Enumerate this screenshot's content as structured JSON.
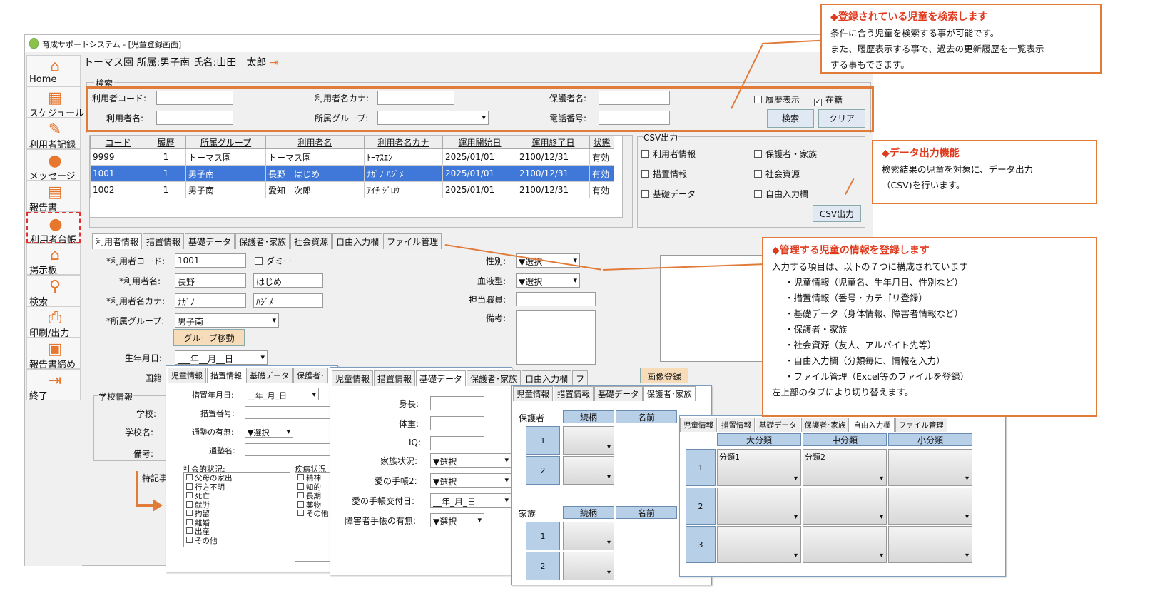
{
  "window": {
    "title": "育成サポートシステム - [児童登録画面]",
    "header": "トーマス園 所属:男子南 氏名:山田　太郎"
  },
  "sidebar": [
    "Home",
    "スケジュール",
    "利用者記録",
    "メッセージ",
    "報告書",
    "利用者台帳",
    "掲示板",
    "検索",
    "印刷/出力",
    "報告書締め",
    "終了"
  ],
  "search": {
    "legend": "検索",
    "code_label": "利用者コード:",
    "kana_label": "利用者名カナ:",
    "guardian_label": "保護者名:",
    "name_label": "利用者名:",
    "group_label": "所属グループ:",
    "phone_label": "電話番号:",
    "history": "履歴表示",
    "enrolled": "在籍",
    "search_btn": "検索",
    "clear_btn": "クリア"
  },
  "grid": {
    "headers": [
      "コード",
      "履歴",
      "所属グループ",
      "利用者名",
      "利用者名カナ",
      "運用開始日",
      "運用終了日",
      "状態"
    ],
    "rows": [
      [
        "9999",
        "1",
        "トーマス園",
        "トーマス園",
        "ﾄｰﾏｽｴﾝ",
        "2025/01/01",
        "2100/12/31",
        "有効"
      ],
      [
        "1001",
        "1",
        "男子南",
        "長野　はじめ",
        "ﾅｶﾞﾉ ﾊｼﾞﾒ",
        "2025/01/01",
        "2100/12/31",
        "有効"
      ],
      [
        "1002",
        "1",
        "男子南",
        "愛知　次郎",
        "ｱｲﾁ ｼﾞﾛｳ",
        "2025/01/01",
        "2100/12/31",
        "有効"
      ]
    ]
  },
  "csv": {
    "legend": "CSV出力",
    "opts": [
      "利用者情報",
      "保護者・家族",
      "措置情報",
      "社会資源",
      "基礎データ",
      "自由入力欄"
    ],
    "btn": "CSV出力"
  },
  "tabs": [
    "利用者情報",
    "措置情報",
    "基礎データ",
    "保護者･家族",
    "社会資源",
    "自由入力欄",
    "ファイル管理"
  ],
  "form": {
    "code_label": "*利用者コード:",
    "code": "1001",
    "dummy": "ダミー",
    "name_label": "*利用者名:",
    "last": "長野",
    "first": "はじめ",
    "kana_label": "*利用者名カナ:",
    "last_kana": "ﾅｶﾞﾉ",
    "first_kana": "ﾊｼﾞﾒ",
    "group_label": "*所属グループ:",
    "group": "男子南",
    "group_move": "グループ移動",
    "birth_label": "生年月日:",
    "birth": "___年__月__日",
    "nation": "国籍",
    "school": "学校情報",
    "school1": "学校:",
    "school2": "学校名:",
    "remark_s": "備考:",
    "special": "特記事",
    "sex_label": "性別:",
    "sex": "▼選択",
    "blood_label": "血液型:",
    "blood": "▼選択",
    "staff_label": "担当職員:",
    "note_label": "備考:",
    "image_btn": "画像登録"
  },
  "p1": {
    "tabs": [
      "児童情報",
      "措置情報",
      "基礎データ",
      "保護者･"
    ],
    "date_label": "措置年月日:",
    "date": "__年_月_日",
    "num_label": "措置番号:",
    "juku_label": "通塾の有無:",
    "juku": "▼選択",
    "jukuname_label": "通塾名:",
    "social": "社会的状況:",
    "social_items": [
      "父母の家出",
      "行方不明",
      "死亡",
      "就労",
      "拘留",
      "離婚",
      "出産",
      "その他"
    ],
    "disease": "疾病状況",
    "disease_items": [
      "精神",
      "知的",
      "長期",
      "薬物",
      "その他"
    ]
  },
  "p2": {
    "tabs": [
      "児童情報",
      "措置情報",
      "基礎データ",
      "保護者･家族",
      "自由入力欄",
      "フ"
    ],
    "height": "身長:",
    "weight": "体重:",
    "iq": "IQ:",
    "family": "家族状況:",
    "family_v": "▼選択",
    "techo": "愛の手帳2:",
    "techo_v": "▼選択",
    "techo_date": "愛の手帳交付日:",
    "techo_date_v": "__年_月_日",
    "shogai": "障害者手帳の有無:",
    "shogai_v": "▼選択"
  },
  "p3": {
    "tabs": [
      "児童情報",
      "措置情報",
      "基礎データ",
      "保護者･家族"
    ],
    "guardian": "保護者",
    "family": "家族",
    "rel": "続柄",
    "name": "名前",
    "n1": "1",
    "n2": "2"
  },
  "p4": {
    "tabs": [
      "児童情報",
      "措置情報",
      "基礎データ",
      "保護者･家族",
      "自由入力欄",
      "ファイル管理"
    ],
    "big": "大分類",
    "mid": "中分類",
    "small": "小分類",
    "r1": "1",
    "r2": "2",
    "r3": "3",
    "v1": "分類1",
    "v2": "分類2"
  },
  "callouts": {
    "search_title": "◆登録されている児童を検索します",
    "search_body": [
      "条件に合う児童を検索する事が可能です。",
      "また、履歴表示する事で、過去の更新履歴を一覧表示",
      "する事もできます。"
    ],
    "csv_title": "◆データ出力機能",
    "csv_body": [
      "検索結果の児童を対象に、データ出力",
      "（CSV)を行います。"
    ],
    "manage_title": "◆管理する児童の情報を登録します",
    "manage_body": [
      "入力する項目は、以下の７つに構成されています",
      "・児童情報（児童名、生年月日、性別など）",
      "・措置情報（番号・カテゴリ登録）",
      "・基礎データ（身体情報、障害者情報など）",
      "・保護者・家族",
      "・社会資源（友人、アルバイト先等）",
      "・自由入力欄（分類毎に、情報を入力）",
      "・ファイル管理（Excel等のファイルを登録）",
      "左上部のタブにより切り替えます。"
    ]
  },
  "colors": {
    "accent": "#e07b39",
    "callout_title": "#e03a1e",
    "selected_row": "#3f78d8"
  }
}
